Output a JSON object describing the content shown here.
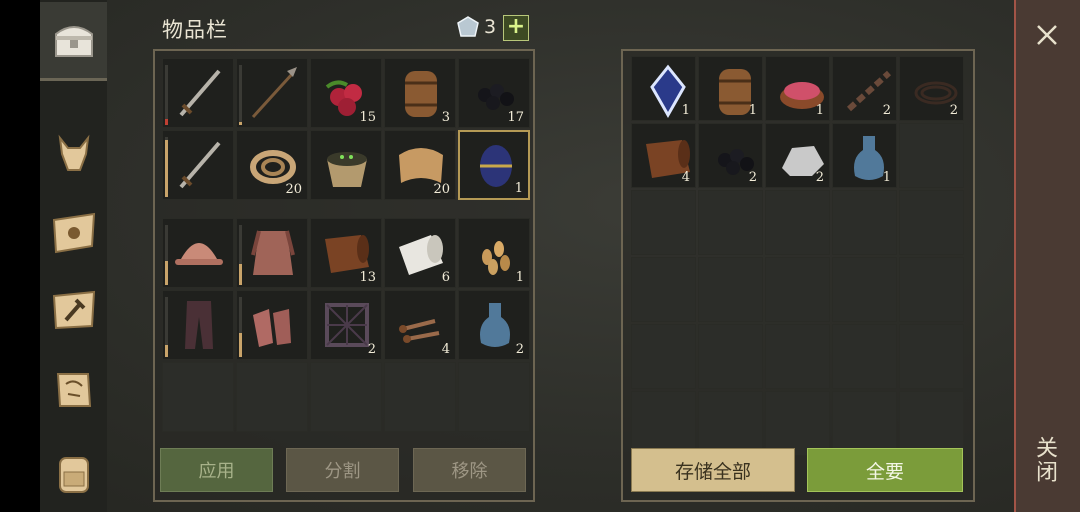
{
  "header": {
    "title": "物品栏",
    "gem_count": "3",
    "plus_label": "+"
  },
  "nav": [
    "chest-icon",
    "wolf-icon",
    "map-sun-icon",
    "craft-hammer-icon",
    "scroll-quest-icon",
    "backpack-icon"
  ],
  "inventory": {
    "main": [
      {
        "item": "sword",
        "count": "",
        "durability": 0.1,
        "dur_color": "red"
      },
      {
        "item": "spear",
        "count": "",
        "durability": 0.05
      },
      {
        "item": "berries",
        "count": "15"
      },
      {
        "item": "barrel",
        "count": "3"
      },
      {
        "item": "coal",
        "count": "17"
      },
      {
        "item": "sword",
        "count": "",
        "durability": 0.95
      },
      {
        "item": "rope",
        "count": "20"
      },
      {
        "item": "basket",
        "count": ""
      },
      {
        "item": "cloth",
        "count": "20"
      },
      {
        "item": "egg",
        "count": "1",
        "selected": true
      }
    ],
    "bag": [
      {
        "item": "helmet",
        "count": "",
        "durability": 0.4
      },
      {
        "item": "chainmail",
        "count": "",
        "durability": 0.35
      },
      {
        "item": "leather",
        "count": "13"
      },
      {
        "item": "bandage",
        "count": "6"
      },
      {
        "item": "seeds",
        "count": "1"
      },
      {
        "item": "pants",
        "count": "",
        "durability": 0.2
      },
      {
        "item": "gloves",
        "count": "",
        "durability": 0.4
      },
      {
        "item": "frame",
        "count": "2"
      },
      {
        "item": "nails",
        "count": "4"
      },
      {
        "item": "bottle",
        "count": "2"
      }
    ],
    "empty_slots": 5
  },
  "storage": {
    "items": [
      {
        "item": "crystal",
        "count": "1"
      },
      {
        "item": "barrel",
        "count": "1"
      },
      {
        "item": "meat",
        "count": "1"
      },
      {
        "item": "chain",
        "count": "2"
      },
      {
        "item": "whip",
        "count": "2"
      },
      {
        "item": "leather",
        "count": "4"
      },
      {
        "item": "coal",
        "count": "2"
      },
      {
        "item": "stone",
        "count": "2"
      },
      {
        "item": "bottle",
        "count": "1"
      }
    ],
    "empty_slots": 21
  },
  "buttons": {
    "apply": "应用",
    "split": "分割",
    "remove": "移除",
    "store_all": "存储全部",
    "take_all": "全要"
  },
  "close": {
    "label": "关闭"
  }
}
